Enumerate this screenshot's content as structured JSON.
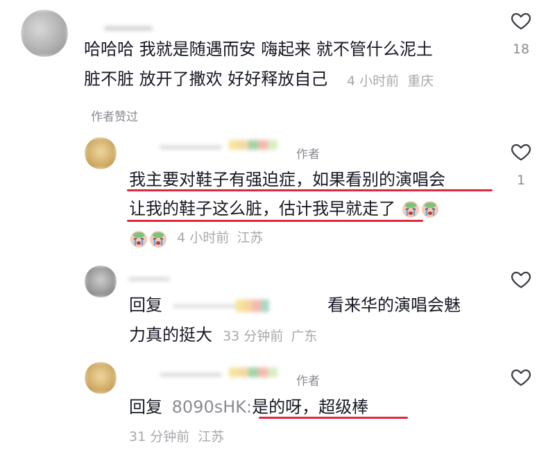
{
  "comments": [
    {
      "text_lines": [
        "哈哈哈 我就是随遇而安 嗨起来 就不管什么泥土",
        "脏不脏 放开了撒欢 好好释放自己"
      ],
      "time": "4 小时前",
      "location": "重庆",
      "likes": "18",
      "liked_by_author": "作者赞过"
    },
    {
      "author_badge": "作者",
      "text_lines": [
        "我主要对鞋子有强迫症，如果看别的演唱会",
        "让我的鞋子这么脏，估计我早就走了"
      ],
      "time": "4 小时前",
      "location": "江苏",
      "likes": "1",
      "emoji": "crying-face"
    },
    {
      "reply_prefix": "回复",
      "text_lines": [
        "看来华的演唱会魅",
        "力真的挺大"
      ],
      "time": "33 分钟前",
      "location": "广东"
    },
    {
      "author_badge": "作者",
      "reply_prefix": "回复",
      "reply_to": "8090sHK:",
      "text": "是的呀，超级棒",
      "time": "31 分钟前",
      "location": "江苏"
    }
  ],
  "icons": {
    "like": "heart-outline-icon"
  },
  "colors": {
    "underline": "#e0283c",
    "meta": "#a8a8ae",
    "text": "#161823"
  }
}
